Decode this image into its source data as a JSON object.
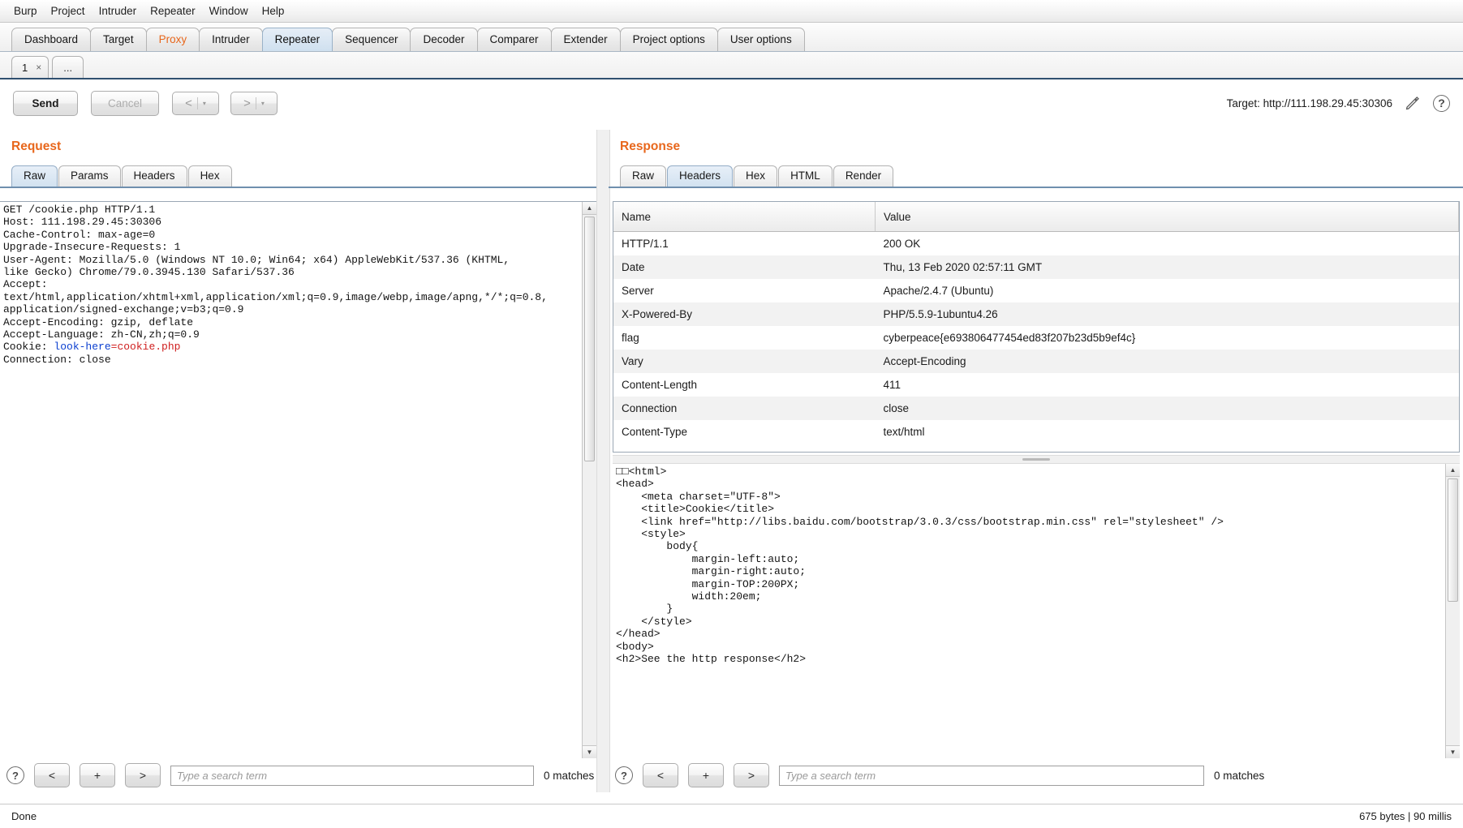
{
  "menubar": {
    "items": [
      "Burp",
      "Project",
      "Intruder",
      "Repeater",
      "Window",
      "Help"
    ]
  },
  "main_tabs": [
    {
      "label": "Dashboard",
      "state": "normal"
    },
    {
      "label": "Target",
      "state": "normal"
    },
    {
      "label": "Proxy",
      "state": "highlight"
    },
    {
      "label": "Intruder",
      "state": "normal"
    },
    {
      "label": "Repeater",
      "state": "active"
    },
    {
      "label": "Sequencer",
      "state": "normal"
    },
    {
      "label": "Decoder",
      "state": "normal"
    },
    {
      "label": "Comparer",
      "state": "normal"
    },
    {
      "label": "Extender",
      "state": "normal"
    },
    {
      "label": "Project options",
      "state": "normal"
    },
    {
      "label": "User options",
      "state": "normal"
    }
  ],
  "repeater_tabs": {
    "items": [
      {
        "label": "1",
        "close": "×"
      }
    ],
    "new_tab_label": "..."
  },
  "toolbar": {
    "send_label": "Send",
    "cancel_label": "Cancel",
    "back_label": "<",
    "forward_label": ">",
    "dropdown_caret": "▾",
    "target_label": "Target: http://111.198.29.45:30306",
    "help_label": "?"
  },
  "request": {
    "title": "Request",
    "tabs": [
      {
        "label": "Raw",
        "active": true
      },
      {
        "label": "Params",
        "active": false
      },
      {
        "label": "Headers",
        "active": false
      },
      {
        "label": "Hex",
        "active": false
      }
    ],
    "lines": [
      {
        "text": "GET /cookie.php HTTP/1.1"
      },
      {
        "text": "Host: 111.198.29.45:30306"
      },
      {
        "text": "Cache-Control: max-age=0"
      },
      {
        "text": "Upgrade-Insecure-Requests: 1"
      },
      {
        "text": "User-Agent: Mozilla/5.0 (Windows NT 10.0; Win64; x64) AppleWebKit/537.36 (KHTML,"
      },
      {
        "text": "like Gecko) Chrome/79.0.3945.130 Safari/537.36"
      },
      {
        "text": "Accept:"
      },
      {
        "text": "text/html,application/xhtml+xml,application/xml;q=0.9,image/webp,image/apng,*/*;q=0.8,"
      },
      {
        "text": "application/signed-exchange;v=b3;q=0.9"
      },
      {
        "text": "Accept-Encoding: gzip, deflate"
      },
      {
        "text": "Accept-Language: zh-CN,zh;q=0.9"
      },
      {
        "text": "Cookie: ",
        "cookie_name": "look-here",
        "cookie_value": "=cookie.php"
      },
      {
        "text": "Connection: close"
      }
    ],
    "search": {
      "help_label": "?",
      "prev_label": "<",
      "add_label": "+",
      "next_label": ">",
      "placeholder": "Type a search term",
      "value": "",
      "matches": "0 matches"
    }
  },
  "response": {
    "title": "Response",
    "tabs": [
      {
        "label": "Raw",
        "active": false
      },
      {
        "label": "Headers",
        "active": true
      },
      {
        "label": "Hex",
        "active": false
      },
      {
        "label": "HTML",
        "active": false
      },
      {
        "label": "Render",
        "active": false
      }
    ],
    "headers_table": {
      "columns": [
        "Name",
        "Value"
      ],
      "rows": [
        {
          "name": "HTTP/1.1",
          "value": "200 OK"
        },
        {
          "name": "Date",
          "value": "Thu, 13 Feb 2020 02:57:11 GMT"
        },
        {
          "name": "Server",
          "value": "Apache/2.4.7 (Ubuntu)"
        },
        {
          "name": "X-Powered-By",
          "value": "PHP/5.5.9-1ubuntu4.26"
        },
        {
          "name": "flag",
          "value": "cyberpeace{e693806477454ed83f207b23d5b9ef4c}"
        },
        {
          "name": "Vary",
          "value": "Accept-Encoding"
        },
        {
          "name": "Content-Length",
          "value": "411"
        },
        {
          "name": "Connection",
          "value": "close"
        },
        {
          "name": "Content-Type",
          "value": "text/html"
        }
      ]
    },
    "body_text": "□□<html>\n<head>\n    <meta charset=\"UTF-8\">\n    <title>Cookie</title>\n    <link href=\"http://libs.baidu.com/bootstrap/3.0.3/css/bootstrap.min.css\" rel=\"stylesheet\" />\n    <style>\n        body{\n            margin-left:auto;\n            margin-right:auto;\n            margin-TOP:200PX;\n            width:20em;\n        }\n    </style>\n</head>\n<body>\n<h2>See the http response</h2>",
    "search": {
      "help_label": "?",
      "prev_label": "<",
      "add_label": "+",
      "next_label": ">",
      "placeholder": "Type a search term",
      "value": "",
      "matches": "0 matches"
    }
  },
  "statusbar": {
    "left": "Done",
    "right": "675 bytes | 90 millis"
  },
  "colors": {
    "accent_orange": "#e8671c",
    "active_tab_blue": "#cfe0ef",
    "cookie_name_blue": "#0b3fd0",
    "cookie_value_red": "#cf1f1f"
  }
}
